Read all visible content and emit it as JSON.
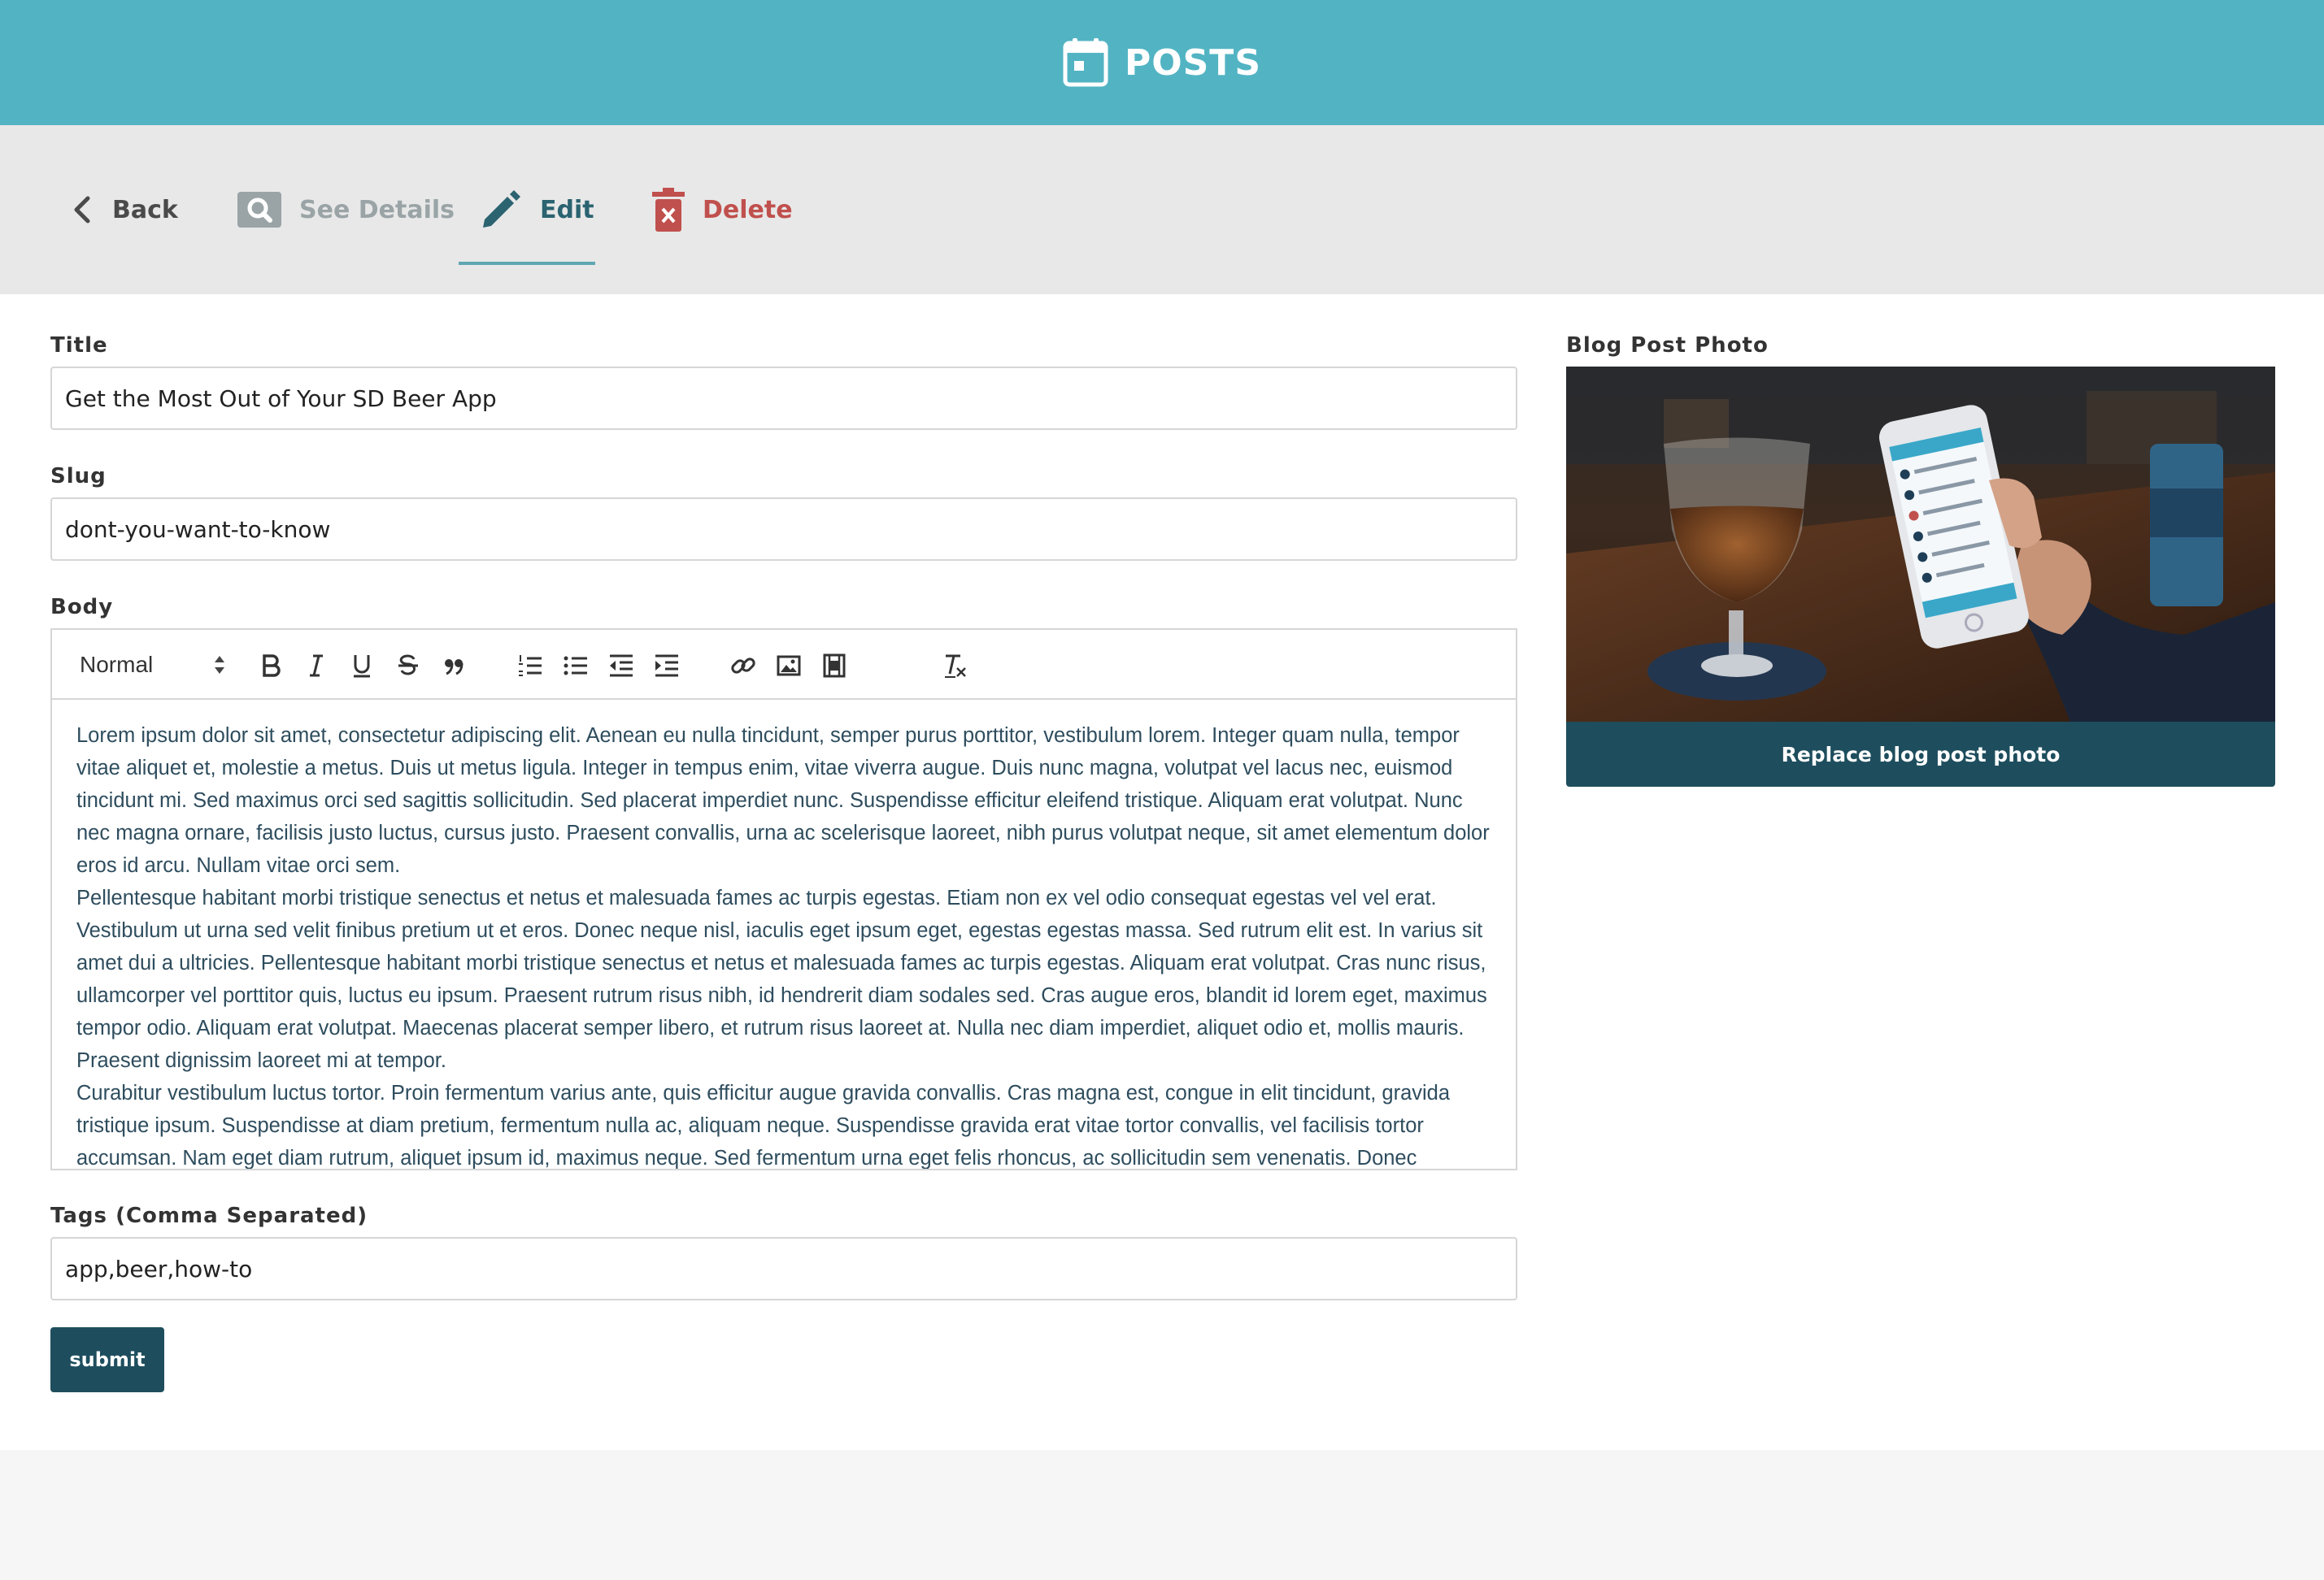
{
  "header": {
    "title": "POSTS",
    "icon": "calendar-icon"
  },
  "actions": {
    "back": {
      "label": "Back",
      "icon": "chevron-left-icon"
    },
    "details": {
      "label": "See Details",
      "icon": "search-icon"
    },
    "edit": {
      "label": "Edit",
      "icon": "pencil-icon",
      "active": true
    },
    "delete": {
      "label": "Delete",
      "icon": "trash-icon"
    }
  },
  "form": {
    "title": {
      "label": "Title",
      "value": "Get the Most Out of Your SD Beer App"
    },
    "slug": {
      "label": "Slug",
      "value": "dont-you-want-to-know"
    },
    "body": {
      "label": "Body",
      "format_select": "Normal",
      "toolbar_icons": [
        "bold-icon",
        "italic-icon",
        "underline-icon",
        "strikethrough-icon",
        "blockquote-icon",
        "ordered-list-icon",
        "bullet-list-icon",
        "outdent-icon",
        "indent-icon",
        "link-icon",
        "image-icon",
        "video-icon",
        "clear-format-icon"
      ],
      "paragraphs": [
        "Lorem ipsum dolor sit amet, consectetur adipiscing elit. Aenean eu nulla tincidunt, semper purus porttitor, vestibulum lorem. Integer quam nulla, tempor vitae aliquet et, molestie a metus. Duis ut metus ligula. Integer in tempus enim, vitae viverra augue. Duis nunc magna, volutpat vel lacus nec, euismod tincidunt mi. Sed maximus orci sed sagittis sollicitudin. Sed placerat imperdiet nunc. Suspendisse efficitur eleifend tristique. Aliquam erat volutpat. Nunc nec magna ornare, facilisis justo luctus, cursus justo. Praesent convallis, urna ac scelerisque laoreet, nibh purus volutpat neque, sit amet elementum dolor eros id arcu. Nullam vitae orci sem.",
        "Pellentesque habitant morbi tristique senectus et netus et malesuada fames ac turpis egestas. Etiam non ex vel odio consequat egestas vel vel erat. Vestibulum ut urna sed velit finibus pretium ut et eros. Donec neque nisl, iaculis eget ipsum eget, egestas egestas massa. Sed rutrum elit est. In varius sit amet dui a ultricies. Pellentesque habitant morbi tristique senectus et netus et malesuada fames ac turpis egestas. Aliquam erat volutpat. Cras nunc risus, ullamcorper vel porttitor quis, luctus eu ipsum. Praesent rutrum risus nibh, id hendrerit diam sodales sed. Cras augue eros, blandit id lorem eget, maximus tempor odio. Aliquam erat volutpat. Maecenas placerat semper libero, et rutrum risus laoreet at. Nulla nec diam imperdiet, aliquet odio et, mollis mauris. Praesent dignissim laoreet mi at tempor.",
        "Curabitur vestibulum luctus tortor. Proin fermentum varius ante, quis efficitur augue gravida convallis. Cras magna est, congue in elit tincidunt, gravida tristique ipsum. Suspendisse at diam pretium, fermentum nulla ac, aliquam neque. Suspendisse gravida erat vitae tortor convallis, vel facilisis tortor accumsan. Nam eget diam rutrum, aliquet ipsum id, maximus neque. Sed fermentum urna eget felis rhoncus, ac sollicitudin sem venenatis. Donec"
      ]
    },
    "tags": {
      "label": "Tags (Comma Separated)",
      "value": "app,beer,how-to"
    },
    "submit_label": "submit"
  },
  "photo": {
    "label": "Blog Post Photo",
    "replace_label": "Replace blog post photo"
  },
  "colors": {
    "header": "#52b4c3",
    "action_bar": "#e8e8e8",
    "primary_dark": "#1e4e5e",
    "edit_active": "#2b6371",
    "delete": "#c0504d",
    "muted": "#9aa4a6"
  }
}
